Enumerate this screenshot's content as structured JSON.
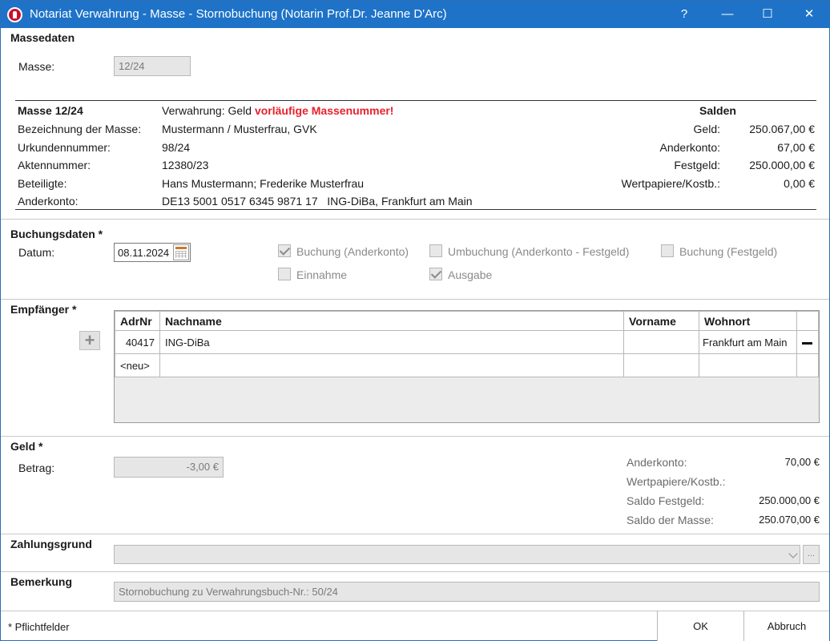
{
  "window": {
    "title": "Notariat Verwahrung - Masse - Stornobuchung (Notarin Prof.Dr. Jeanne D'Arc)",
    "help_label": "?",
    "minimize_label": "—",
    "maximize_label": "☐",
    "close_label": "✕"
  },
  "massedaten": {
    "title": "Massedaten",
    "masse_label": "Masse:",
    "masse_value": "12/24"
  },
  "info": {
    "masse_heading": "Masse 12/24",
    "verwahrung_prefix": "Verwahrung: Geld",
    "verwahrung_warning": "vorläufige Massenummer!",
    "rows": [
      {
        "label": "Bezeichnung der Masse:",
        "value": "Mustermann / Musterfrau, GVK"
      },
      {
        "label": "Urkundennummer:",
        "value": "98/24"
      },
      {
        "label": "Aktennummer:",
        "value": "12380/23"
      },
      {
        "label": "Beteiligte:",
        "value": "Hans Mustermann; Frederike Musterfrau"
      },
      {
        "label": "Anderkonto:",
        "value": "DE13 5001 0517 6345 9871 17   ING-DiBa, Frankfurt am Main"
      }
    ],
    "salden_heading": "Salden",
    "salden": [
      {
        "label": "Geld:",
        "value": "250.067,00 €"
      },
      {
        "label": "Anderkonto:",
        "value": "67,00 €"
      },
      {
        "label": "Festgeld:",
        "value": "250.000,00 €"
      },
      {
        "label": "Wertpapiere/Kostb.:",
        "value": "0,00 €"
      }
    ]
  },
  "buchungsdaten": {
    "title": "Buchungsdaten *",
    "datum_label": "Datum:",
    "datum_value": "08.11.2024",
    "checkboxes": [
      {
        "label": "Buchung (Anderkonto)",
        "checked": true
      },
      {
        "label": "Umbuchung (Anderkonto - Festgeld)",
        "checked": false
      },
      {
        "label": "Buchung (Festgeld)",
        "checked": false
      },
      {
        "label": "Einnahme",
        "checked": false
      },
      {
        "label": "Ausgabe",
        "checked": true
      }
    ]
  },
  "empfaenger": {
    "title": "Empfänger *",
    "columns": [
      "AdrNr",
      "Nachname",
      "Vorname",
      "Wohnort"
    ],
    "rows": [
      {
        "adrnr": "40417",
        "nachname": "ING-DiBa",
        "vorname": "",
        "wohnort": "Frankfurt am Main"
      }
    ],
    "new_row_label": "<neu>"
  },
  "geld": {
    "title": "Geld *",
    "betrag_label": "Betrag:",
    "betrag_value": "-3,00 €",
    "summary": [
      {
        "label": "Anderkonto:",
        "value": "70,00 €"
      },
      {
        "label": "Wertpapiere/Kostb.:",
        "value": ""
      },
      {
        "label": "Saldo Festgeld:",
        "value": "250.000,00 €"
      },
      {
        "label": "Saldo der Masse:",
        "value": "250.070,00 €"
      }
    ]
  },
  "zahlungsgrund": {
    "title": "Zahlungsgrund",
    "value": "",
    "dots_label": "..."
  },
  "bemerkung": {
    "title": "Bemerkung",
    "value": "Stornobuchung zu Verwahrungsbuch-Nr.: 50/24"
  },
  "footer": {
    "pflicht_label": "* Pflichtfelder",
    "ok_label": "OK",
    "abbruch_label": "Abbruch"
  }
}
